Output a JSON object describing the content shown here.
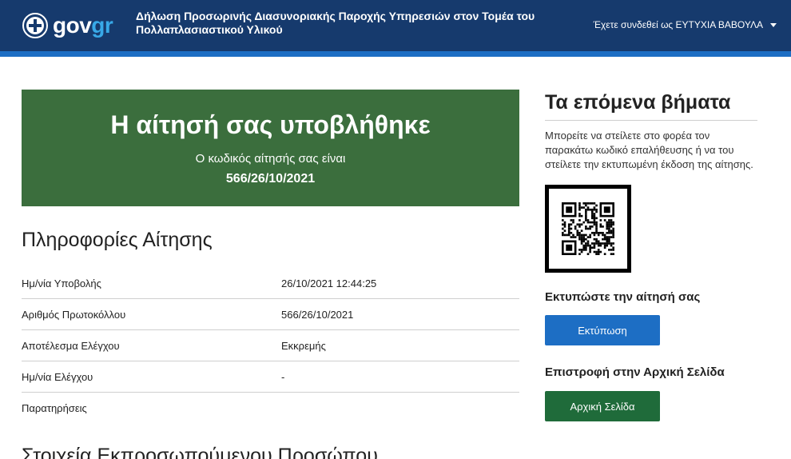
{
  "header": {
    "logo_gov": "gov",
    "logo_gr": "gr",
    "service_title": "Δήλωση Προσωρινής Διασυνοριακής Παροχής Υπηρεσιών στον Τομέα του Πολλαπλασιαστικού Υλικού",
    "user_label": "Έχετε συνδεθεί ως ΕΥΤΥΧΙΑ ΒΑΒΟΥΛΑ"
  },
  "success": {
    "title": "Η αίτησή σας υποβλήθηκε",
    "subtitle": "Ο κωδικός αίτησής σας είναι",
    "code": "566/26/10/2021"
  },
  "info": {
    "title": "Πληροφορίες Αίτησης",
    "rows": [
      {
        "label": "Ημ/νία Υποβολής",
        "value": "26/10/2021 12:44:25"
      },
      {
        "label": "Αριθμός Πρωτοκόλλου",
        "value": "566/26/10/2021"
      },
      {
        "label": "Αποτέλεσμα Ελέγχου",
        "value": "Εκκρεμής"
      },
      {
        "label": "Ημ/νία Ελέγχου",
        "value": "-"
      },
      {
        "label": "Παρατηρήσεις",
        "value": ""
      }
    ]
  },
  "representative": {
    "title": "Στοιχεία Εκπροσωπούμενου Προσώπου"
  },
  "next_steps": {
    "title": "Τα επόμενα βήματα",
    "description": "Μπορείτε να στείλετε στο φορέα τον παρακάτω κωδικό επαλήθευσης ή να του στείλετε την εκτυπωμένη έκδοση της αίτησης.",
    "print_heading": "Εκτυπώστε την αίτησή σας",
    "print_button": "Εκτύπωση",
    "home_heading": "Επιστροφή στην Αρχική Σελίδα",
    "home_button": "Αρχική Σελίδα"
  },
  "colors": {
    "header": "#163a6d",
    "accent_blue": "#1d6ec4",
    "success_green": "#3b6e3d",
    "button_green": "#1f6b3a"
  }
}
